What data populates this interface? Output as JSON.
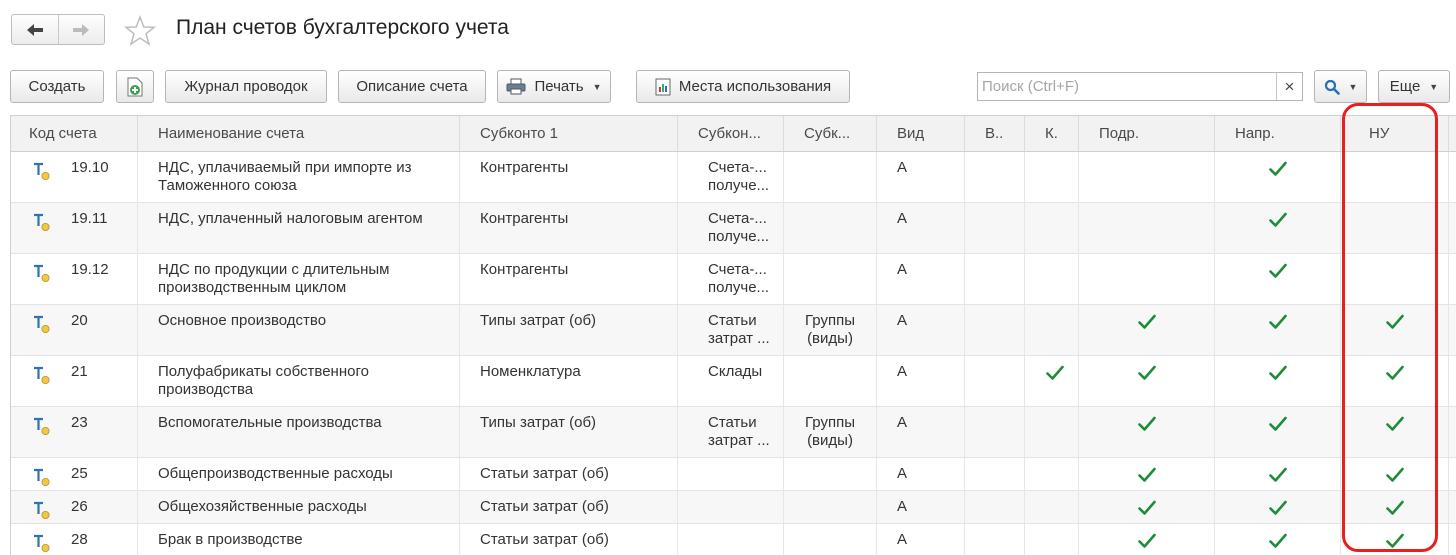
{
  "window": {
    "title": "План счетов бухгалтерского учета"
  },
  "toolbar": {
    "create": "Создать",
    "journal": "Журнал проводок",
    "description": "Описание счета",
    "print": "Печать",
    "usage": "Места использования",
    "search_placeholder": "Поиск (Ctrl+F)",
    "clear": "×",
    "more": "Еще"
  },
  "columns": {
    "code": "Код счета",
    "name": "Наименование счета",
    "sub1": "Субконто 1",
    "sub2": "Субкон...",
    "sub3": "Субк...",
    "type": "Вид",
    "v": "В..",
    "k": "К.",
    "podr": "Подр.",
    "napr": "Напр.",
    "nu": "НУ"
  },
  "rows": [
    {
      "code": "19.10",
      "name1": "НДС, уплачиваемый при импорте из",
      "name2": "Таможенного союза",
      "sub1": "Контрагенты",
      "sub2a": "Счета-...",
      "sub2b": "получе...",
      "sub3a": "",
      "sub3b": "",
      "type": "А",
      "k": false,
      "podr": false,
      "napr": true,
      "nu": false
    },
    {
      "code": "19.11",
      "name1": "НДС, уплаченный налоговым агентом",
      "name2": "",
      "sub1": "Контрагенты",
      "sub2a": "Счета-...",
      "sub2b": "получе...",
      "sub3a": "",
      "sub3b": "",
      "type": "А",
      "k": false,
      "podr": false,
      "napr": true,
      "nu": false
    },
    {
      "code": "19.12",
      "name1": "НДС по продукции с длительным",
      "name2": "производственным циклом",
      "sub1": "Контрагенты",
      "sub2a": "Счета-...",
      "sub2b": "получе...",
      "sub3a": "",
      "sub3b": "",
      "type": "А",
      "k": false,
      "podr": false,
      "napr": true,
      "nu": false
    },
    {
      "code": "20",
      "name1": "Основное производство",
      "name2": "",
      "sub1": "Типы затрат (об)",
      "sub2a": "Статьи",
      "sub2b": "затрат ...",
      "sub3a": "Группы",
      "sub3b": "(виды)",
      "type": "А",
      "k": false,
      "podr": true,
      "napr": true,
      "nu": true
    },
    {
      "code": "21",
      "name1": "Полуфабрикаты собственного",
      "name2": "производства",
      "sub1": "Номенклатура",
      "sub2a": "Склады",
      "sub2b": "",
      "sub3a": "",
      "sub3b": "",
      "type": "А",
      "k": true,
      "podr": true,
      "napr": true,
      "nu": true
    },
    {
      "code": "23",
      "name1": "Вспомогательные производства",
      "name2": "",
      "sub1": "Типы затрат (об)",
      "sub2a": "Статьи",
      "sub2b": "затрат ...",
      "sub3a": "Группы",
      "sub3b": "(виды)",
      "type": "А",
      "k": false,
      "podr": true,
      "napr": true,
      "nu": true
    },
    {
      "code": "25",
      "name1": "Общепроизводственные расходы",
      "name2": "",
      "sub1": "Статьи затрат (об)",
      "sub2a": "",
      "sub2b": "",
      "sub3a": "",
      "sub3b": "",
      "type": "А",
      "k": false,
      "podr": true,
      "napr": true,
      "nu": true
    },
    {
      "code": "26",
      "name1": "Общехозяйственные расходы",
      "name2": "",
      "sub1": "Статьи затрат (об)",
      "sub2a": "",
      "sub2b": "",
      "sub3a": "",
      "sub3b": "",
      "type": "А",
      "k": false,
      "podr": true,
      "napr": true,
      "nu": true
    },
    {
      "code": "28",
      "name1": "Брак в производстве",
      "name2": "",
      "sub1": "Статьи затрат (об)",
      "sub2a": "",
      "sub2b": "",
      "sub3a": "",
      "sub3b": "",
      "type": "А",
      "k": false,
      "podr": true,
      "napr": true,
      "nu": true
    }
  ],
  "colors": {
    "accent": "#1e8c3a",
    "annotation": "#e81f1f",
    "search_icon": "#2a6fb8"
  },
  "icons": {
    "account": "account-icon",
    "check": "check-icon"
  }
}
